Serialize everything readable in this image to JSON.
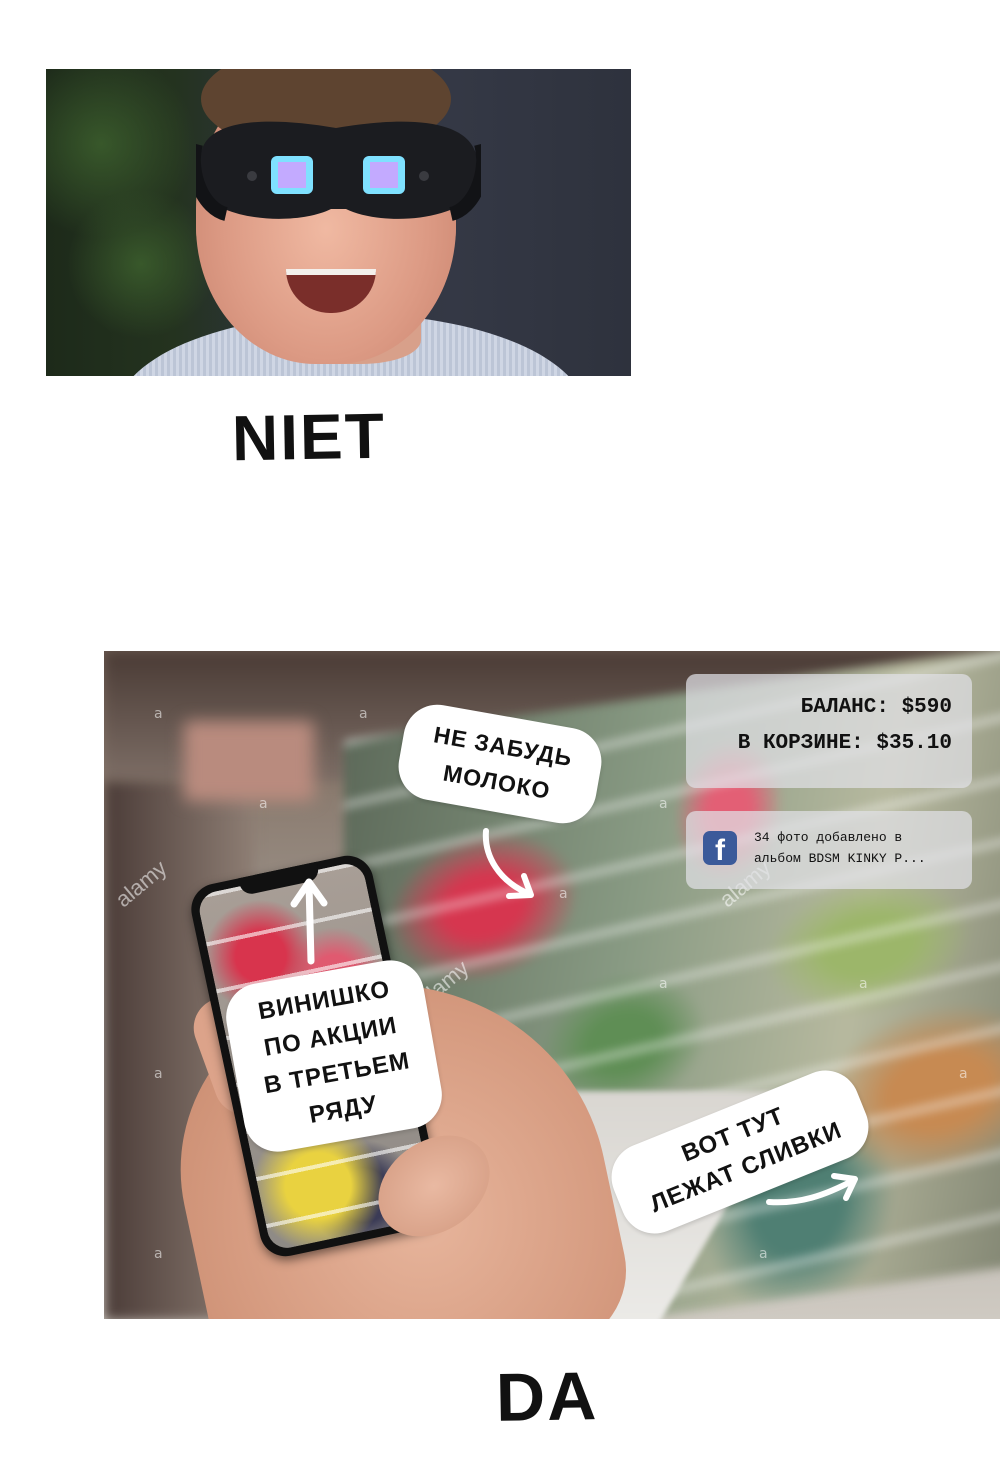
{
  "captions": {
    "top": "NIET",
    "bottom": "DA"
  },
  "hud": {
    "balance_line": "БАЛАНС: $590",
    "cart_line": "В КОРЗИНЕ: $35.10",
    "notification_line1": "34 фото добавлено в",
    "notification_line2": "альбом BDSM KINKY P..."
  },
  "stickers": {
    "milk": [
      "НЕ ЗАБУДЬ",
      "МОЛОКО"
    ],
    "wine": [
      "ВИНИШКО",
      "ПО АКЦИИ",
      "В ТРЕТЬЕМ",
      "РЯДУ"
    ],
    "cream": [
      "ВОТ ТУТ",
      "ЛЕЖАТ СЛИВКИ"
    ]
  },
  "watermarks": {
    "brand": "alamy",
    "letter": "a"
  },
  "icons": {
    "notification": "facebook-icon",
    "arrows": [
      "arrow-down-right-icon",
      "arrow-up-icon",
      "arrow-right-icon"
    ]
  },
  "colors": {
    "facebook_blue": "#3b5a9a",
    "hud_panel": "#e1e1e6",
    "sticker": "#ffffff"
  }
}
